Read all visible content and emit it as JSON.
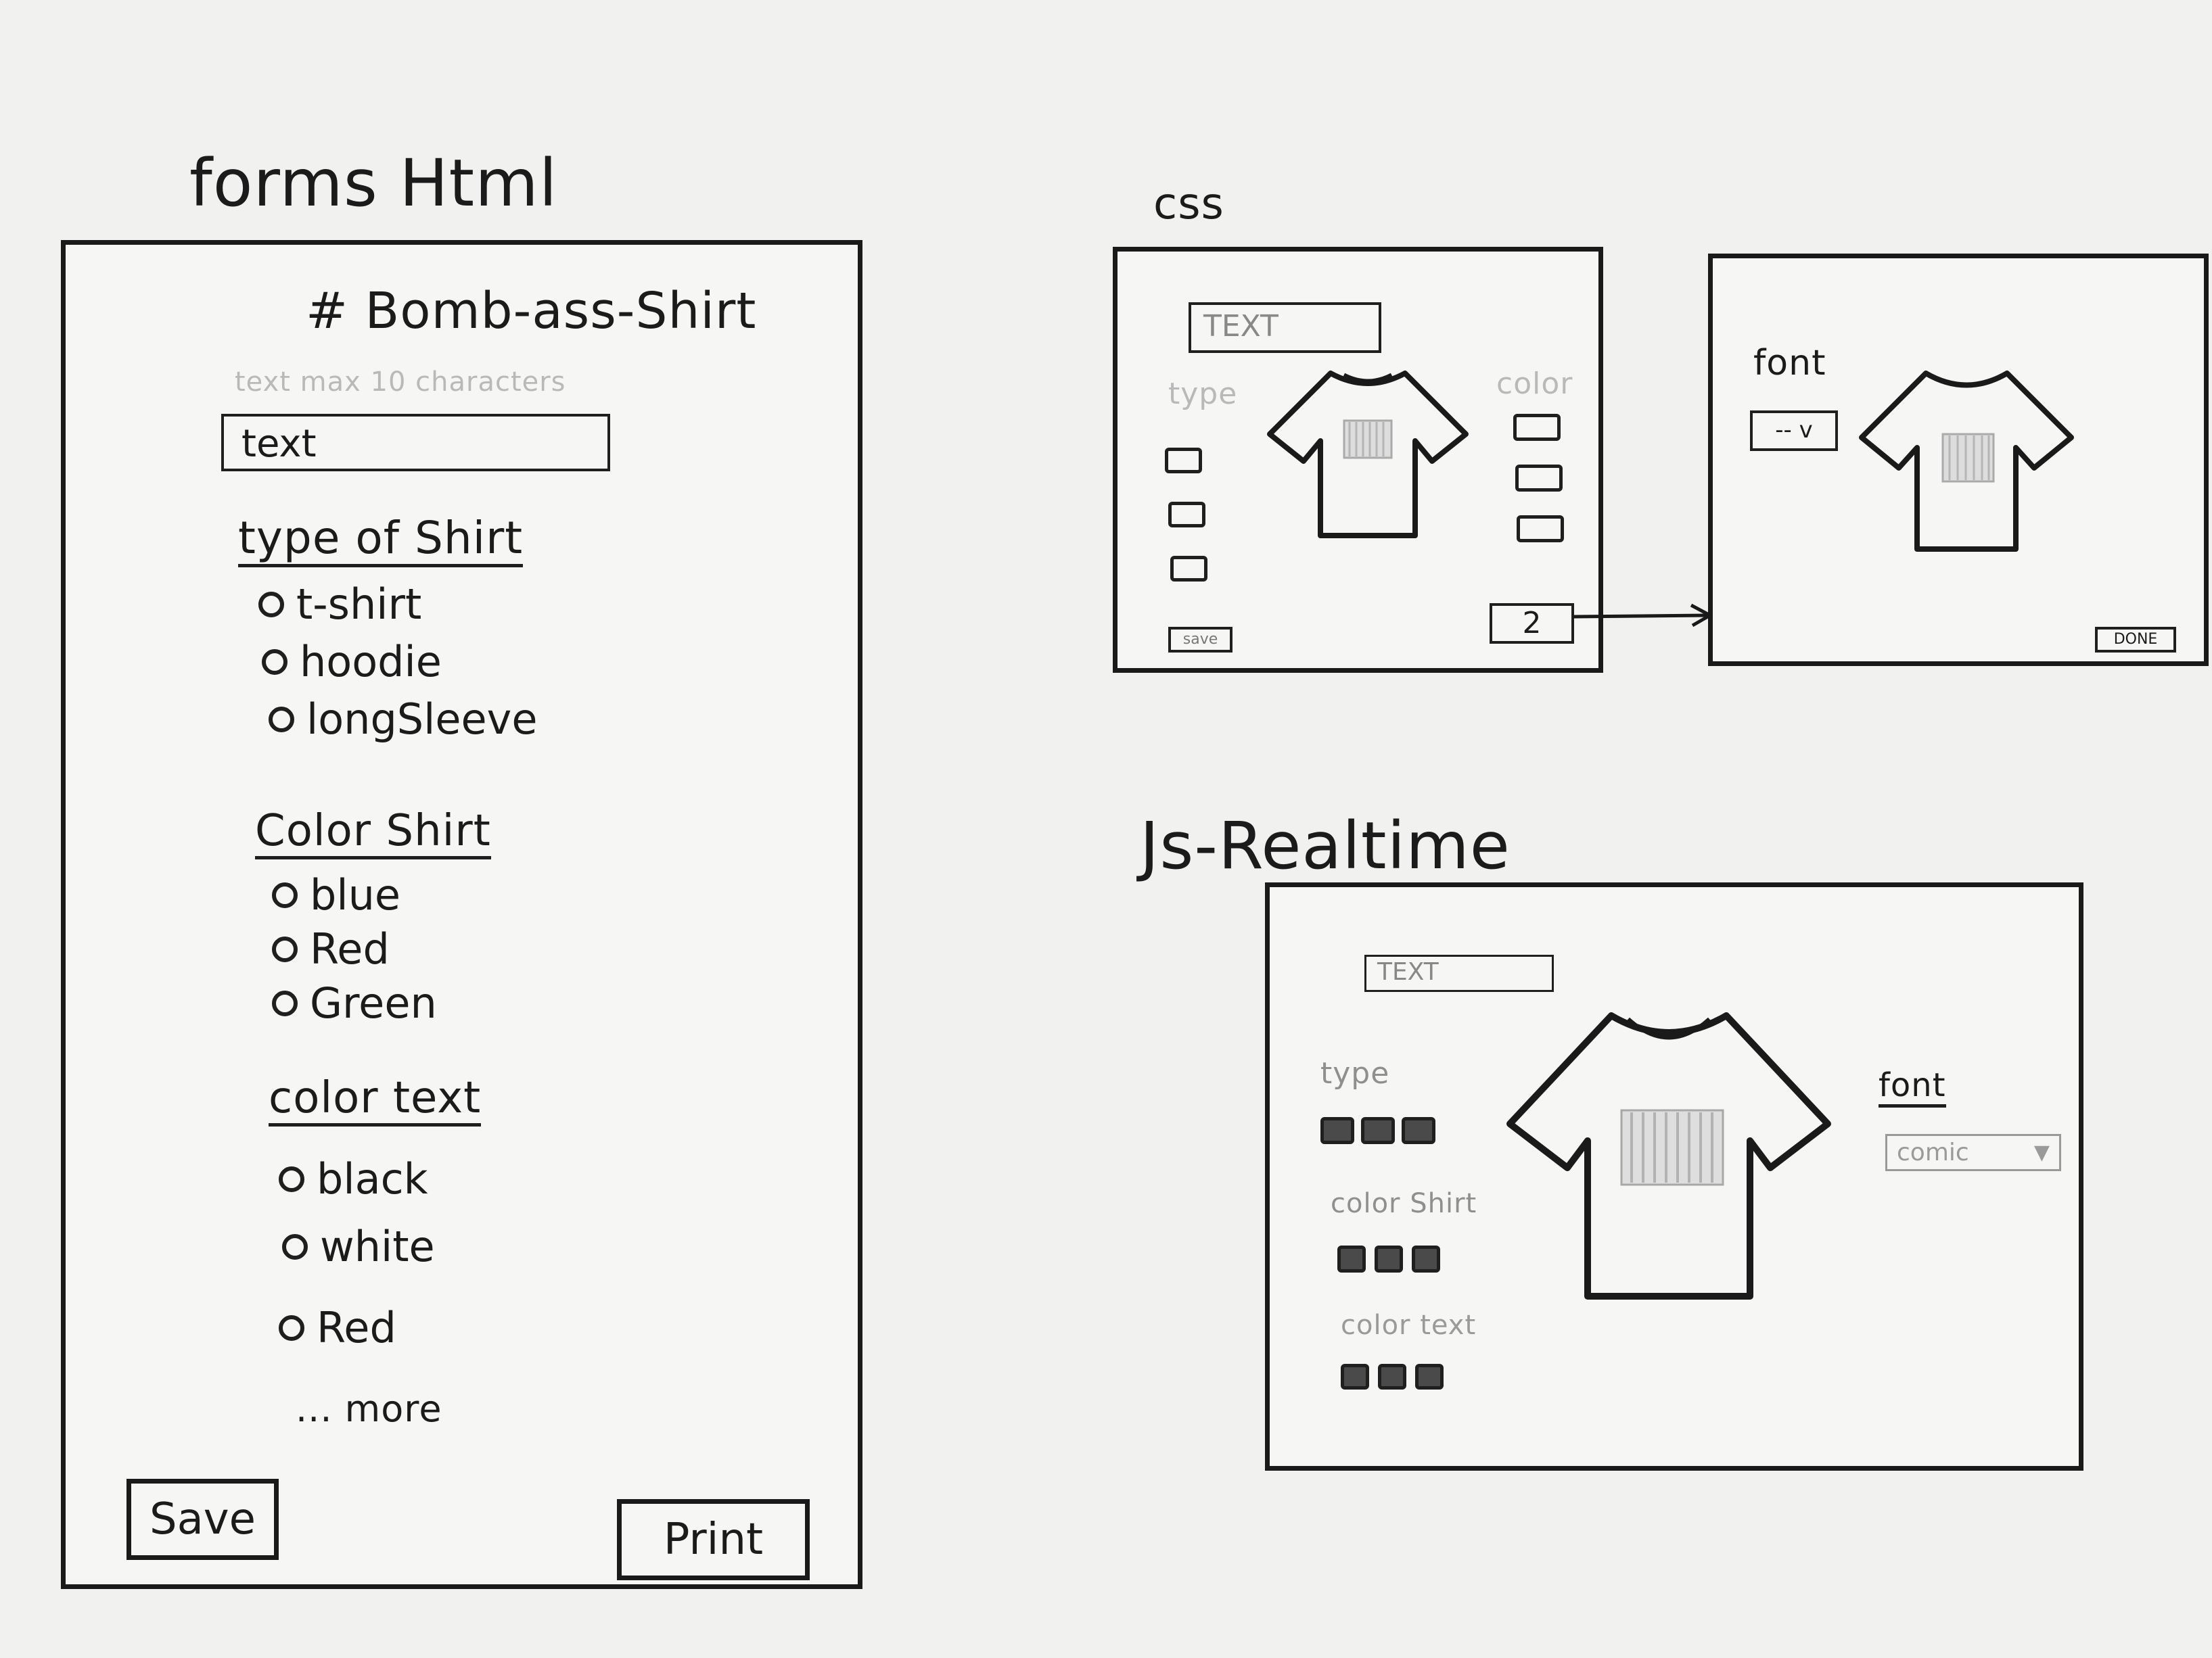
{
  "headings": {
    "forms": "forms Html",
    "css": "css",
    "js": "Js-Realtime"
  },
  "form_panel": {
    "title": "# Bomb-ass-Shirt",
    "text_hint": "text max 10 characters",
    "text_input_value": "text",
    "type_heading": "type of Shirt",
    "type_options": [
      "t-shirt",
      "hoodie",
      "longSleeve"
    ],
    "color_heading": "Color Shirt",
    "color_options": [
      "blue",
      "Red",
      "Green"
    ],
    "text_color_heading": "color text",
    "text_color_options": [
      "black",
      "white",
      "Red"
    ],
    "more": "... more",
    "save": "Save",
    "print": "Print"
  },
  "css_panel": {
    "text_input": "TEXT",
    "type_label": "type",
    "color_label": "color",
    "save": "save",
    "next": "2"
  },
  "css_panel2": {
    "font_label": "font",
    "font_select": "-- v",
    "done": "DONE"
  },
  "js_panel": {
    "text_input": "TEXT",
    "type_label": "type",
    "color_shirt_label": "color Shirt",
    "color_text_label": "color text",
    "font_label": "font",
    "font_select": "comic"
  }
}
